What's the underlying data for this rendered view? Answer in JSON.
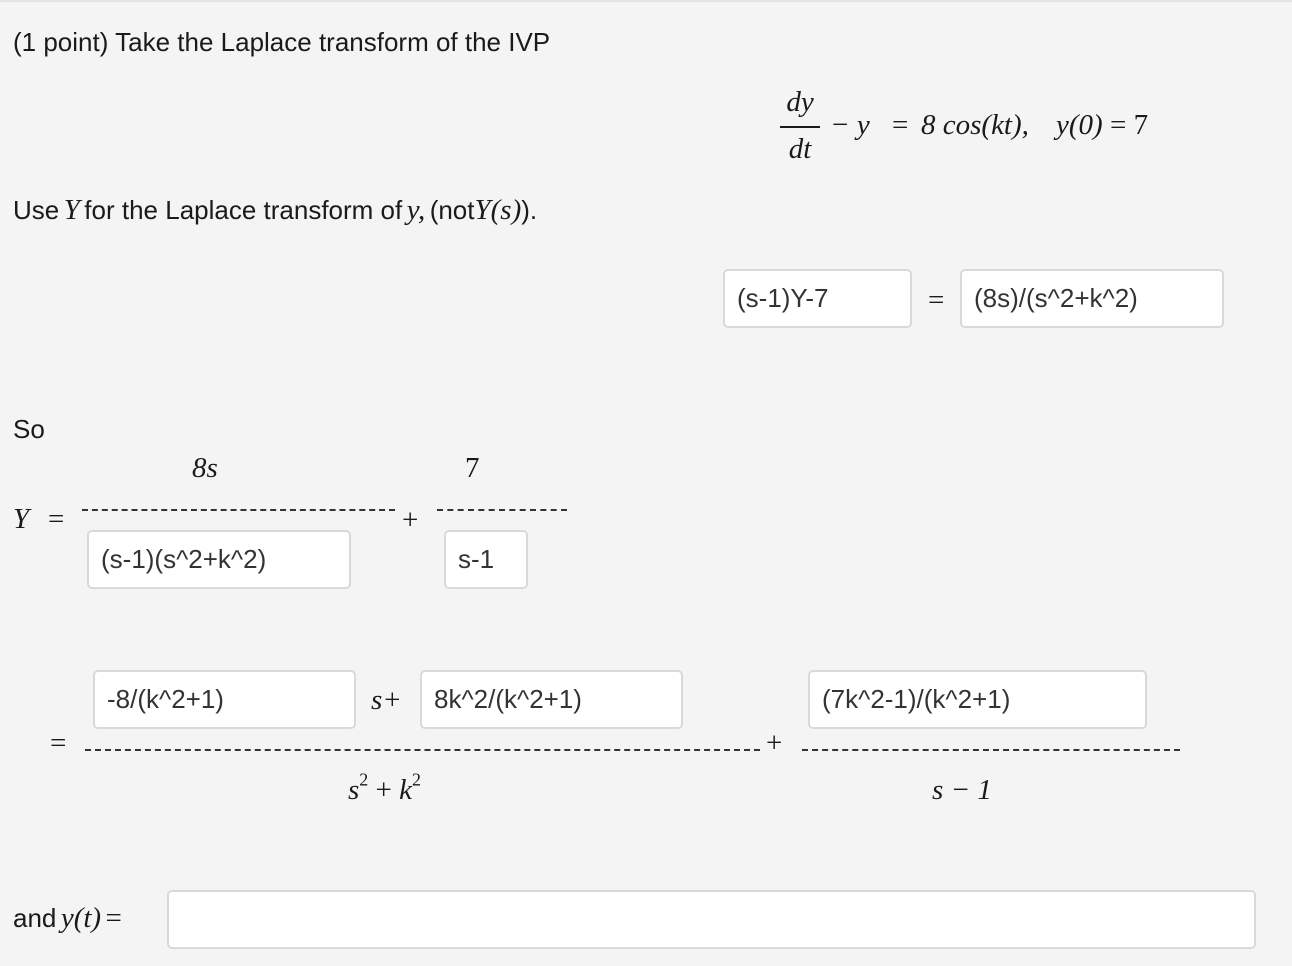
{
  "problem": {
    "prompt": "(1 point) Take the Laplace transform of the IVP",
    "ivp": {
      "numerator": "dy",
      "denominator": "dt",
      "rest_minus_y": "− y",
      "rest_equals": "=",
      "rest_rhs": "8 cos(kt),",
      "initial_condition": "y(0)",
      "ic_equals": "= 7"
    },
    "instruction": {
      "part1": "Use",
      "Y": "Y",
      "part2": "for the Laplace transform of",
      "y": "y,",
      "part3": "(not",
      "Ys": "Y(s)",
      "part4": ")."
    }
  },
  "transform_equation": {
    "lhs_value": "(s-1)Y-7",
    "equals": "=",
    "rhs_value": "(8s)/(s^2+k^2)"
  },
  "so_label": "So",
  "y_expression": {
    "Y_label": "Y",
    "equals": "=",
    "term1_numerator": "8s",
    "term1_denominator_value": "(s-1)(s^2+k^2)",
    "plus": "+",
    "term2_numerator": "7",
    "term2_denominator_value": "s-1"
  },
  "partial_fractions": {
    "equals": "=",
    "A_value": "-8/(k^2+1)",
    "s_plus": "s+",
    "B_value": "8k^2/(k^2+1)",
    "denominator1_base_s": "s",
    "denominator1_exp": "2",
    "denominator1_plus": "+",
    "denominator1_base_k": "k",
    "denominator1_exp2": "2",
    "plus": "+",
    "C_value": "(7k^2-1)/(k^2+1)",
    "denominator2": "s − 1"
  },
  "solution": {
    "label_and": "and",
    "label_y": "y(t)",
    "label_equals": "=",
    "value": ""
  }
}
